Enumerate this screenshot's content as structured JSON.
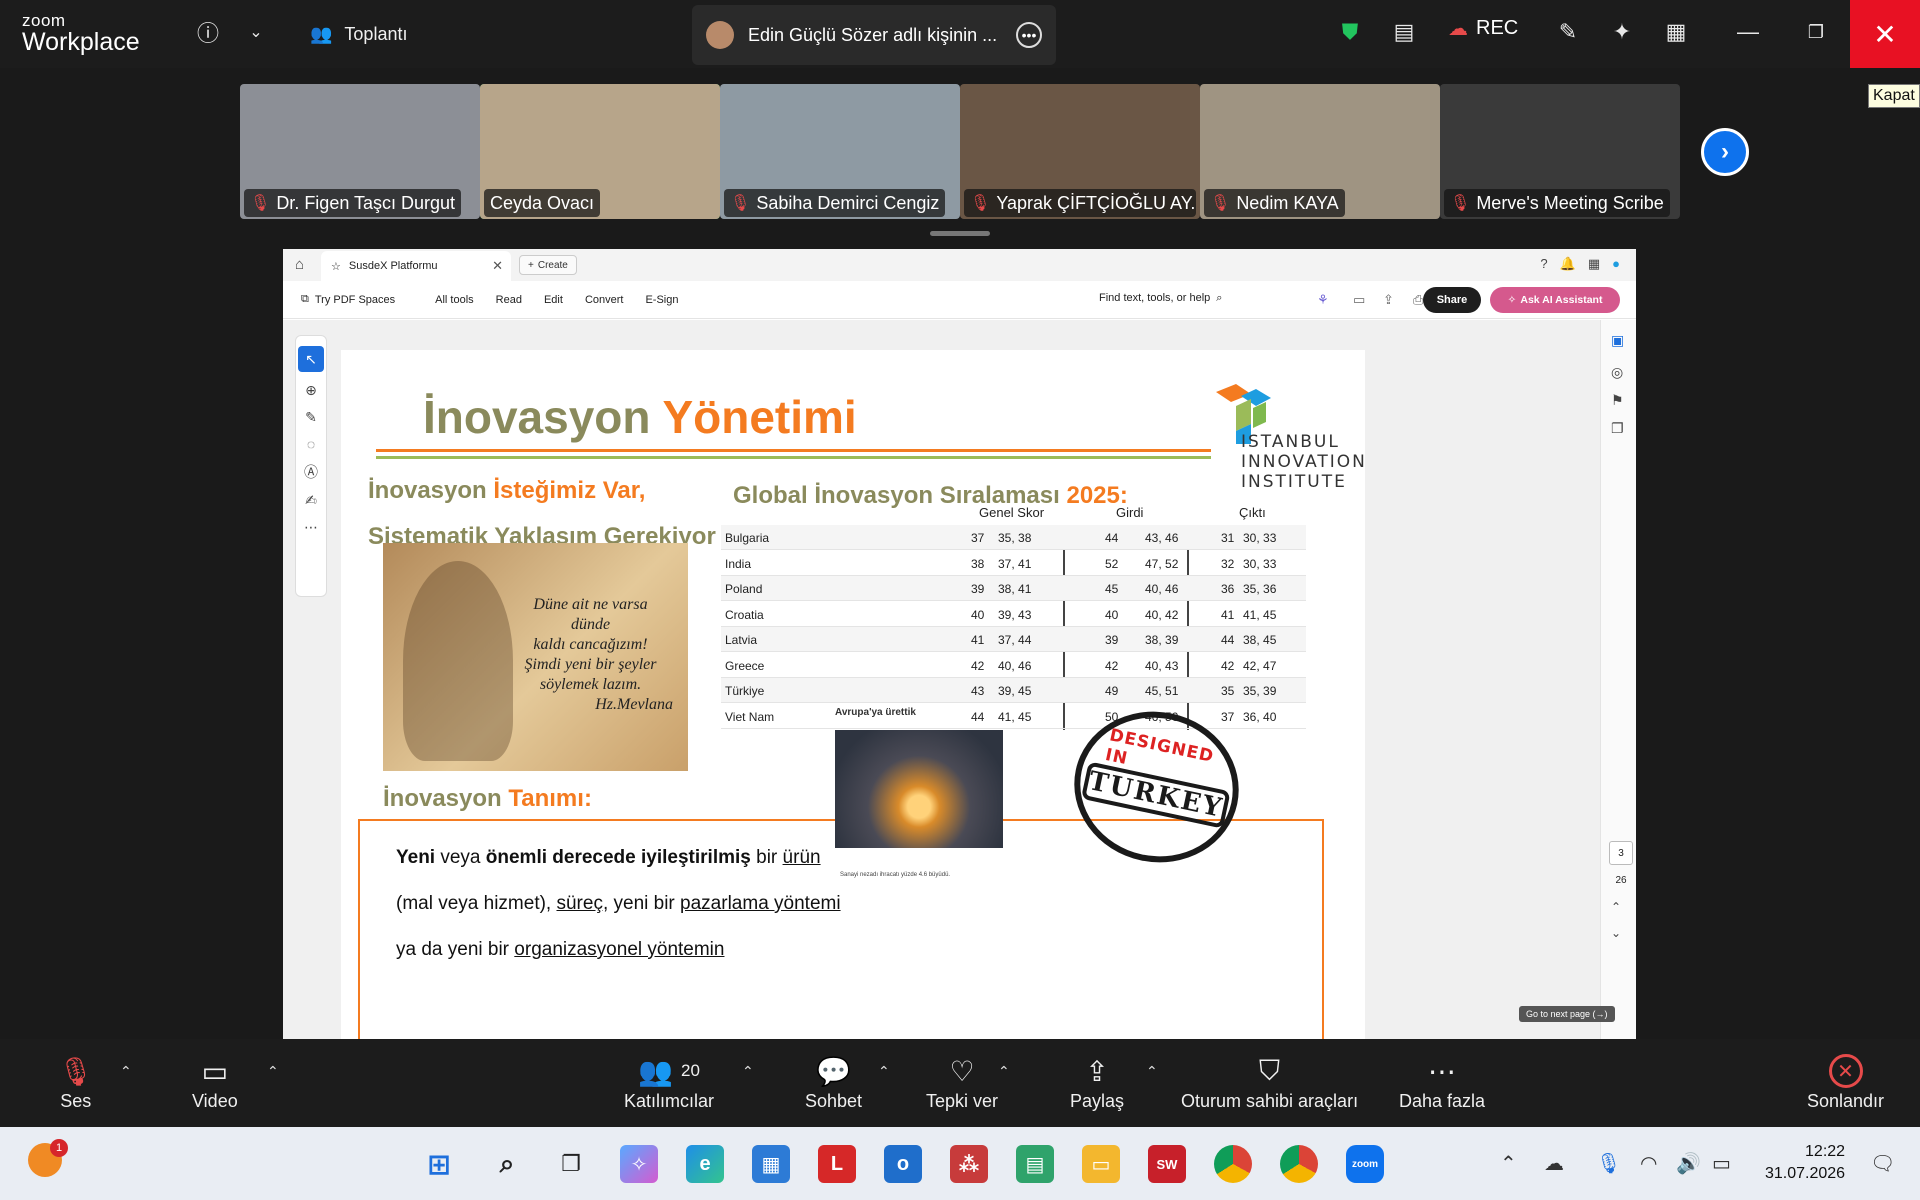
{
  "app": {
    "brand_small": "zoom",
    "brand_large": "Workplace"
  },
  "topbar": {
    "meeting_label": "Toplantı",
    "share_title": "Edin Güçlü Sözer adlı kişinin ...",
    "rec_label": "REC",
    "close_tooltip": "Kapat"
  },
  "participants": [
    {
      "name": "Dr. Figen Taşcı Durgut",
      "muted": true,
      "bg": "#8c8f96"
    },
    {
      "name": "Ceyda Ovacı",
      "muted": false,
      "bg": "#b7a58a"
    },
    {
      "name": "Sabiha Demirci Cengiz",
      "muted": true,
      "bg": "#8e9aa3"
    },
    {
      "name": "Yaprak ÇİFTÇİOĞLU AY...",
      "muted": true,
      "bg": "#6a5645"
    },
    {
      "name": "Nedim KAYA",
      "muted": true,
      "bg": "#9f9482"
    },
    {
      "name": "Merve's Meeting Scribe",
      "muted": true,
      "bg": "#3a3a3a"
    }
  ],
  "browser": {
    "tab_title": "SusdeX Platformu",
    "create_label": "Create",
    "toolbar": {
      "try_pdf": "Try PDF Spaces",
      "all_tools": "All tools",
      "read": "Read",
      "edit": "Edit",
      "convert": "Convert",
      "esign": "E-Sign",
      "find": "Find text, tools, or help",
      "share": "Share",
      "ask_ai": "Ask AI Assistant"
    },
    "page_current": "3",
    "page_total": "26",
    "go_next_tip": "Go to next page (→)"
  },
  "slide": {
    "title_a": "İnovasyon",
    "title_b": "Yönetimi",
    "logo_lines": [
      "ISTANBUL",
      "INNOVATION",
      "INSTITUTE"
    ],
    "left_h1_a": "İnovasyon",
    "left_h1_b": "İsteğimiz Var,",
    "left_h2": "Sistematik Yaklaşım Gerekiyor",
    "quote": [
      "Düne ait ne varsa",
      "dünde",
      "kaldı cancağızım!",
      "Şimdi yeni bir şeyler",
      "söylemek lazım.",
      "Hz.Mevlana"
    ],
    "tanim_a": "İnovasyon",
    "tanim_b": "Tanımı:",
    "def": {
      "b1": "Yeni",
      "t1": " veya ",
      "b2": "önemli derecede iyileştirilmiş",
      "t2": " bir ",
      "u1": "ürün",
      "t3": "(mal veya hizmet), ",
      "u2": "süreç",
      "t4": ", yeni bir ",
      "u3": "pazarlama yöntemi",
      "t5": "ya da yeni bir ",
      "u4": "organizasyonel yöntemin"
    },
    "global_title_a": "Global",
    "global_title_b": "İnovasyon Sıralaması",
    "global_title_c": "2025:",
    "table": {
      "headers": [
        "Genel Skor",
        "Girdi",
        "Çıktı"
      ],
      "rows": [
        [
          "Bulgaria",
          "37",
          "35, 38",
          "44",
          "43, 46",
          "31",
          "30, 33"
        ],
        [
          "India",
          "38",
          "37, 41",
          "52",
          "47, 52",
          "32",
          "30, 33"
        ],
        [
          "Poland",
          "39",
          "38, 41",
          "45",
          "40, 46",
          "36",
          "35, 36"
        ],
        [
          "Croatia",
          "40",
          "39, 43",
          "40",
          "40, 42",
          "41",
          "41, 45"
        ],
        [
          "Latvia",
          "41",
          "37, 44",
          "39",
          "38, 39",
          "44",
          "38, 45"
        ],
        [
          "Greece",
          "42",
          "40, 46",
          "42",
          "40, 43",
          "42",
          "42, 47"
        ],
        [
          "Türkiye",
          "43",
          "39, 45",
          "49",
          "45, 51",
          "35",
          "35, 39"
        ],
        [
          "Viet Nam",
          "44",
          "41, 45",
          "50",
          "46, 50",
          "37",
          "36, 40"
        ]
      ]
    },
    "steel_caption": "Avrupa'ya ürettik",
    "steel_small": "Sanayi nezadı ihracatı yüzde 4.6 büyüdü.",
    "stamp_top": "DESIGNED IN",
    "stamp_main": "TURKEY"
  },
  "controls": {
    "audio": "Ses",
    "video": "Video",
    "participants": "Katılımcılar",
    "participants_count": "20",
    "chat": "Sohbet",
    "react": "Tepki ver",
    "share": "Paylaş",
    "host_tools": "Oturum sahibi araçları",
    "more": "Daha fazla",
    "end": "Sonlandır"
  },
  "taskbar": {
    "notif_count": "1",
    "time": "12:22",
    "date": "31.07.2026"
  },
  "colors": {
    "zoom_blue": "#0e72ed",
    "end_red": "#e64a4a",
    "slide_orange": "#f47b20",
    "slide_olive": "#8a8a5c",
    "slide_green": "#9bbb59"
  }
}
